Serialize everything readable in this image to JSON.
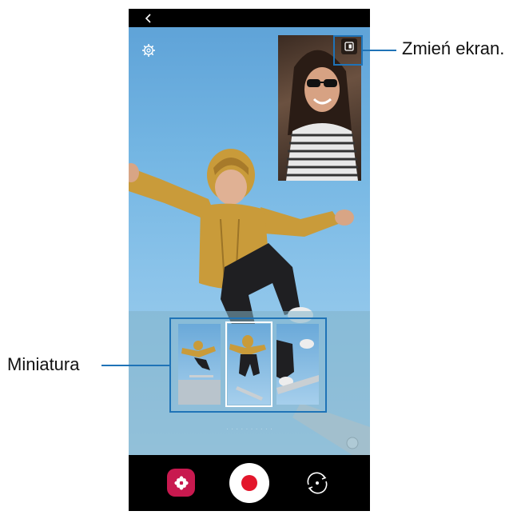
{
  "callouts": {
    "switch_screen": "Zmień ekran.",
    "thumbnail": "Miniatura"
  },
  "icons": {
    "back": "chevron-left-icon",
    "settings": "gear-icon",
    "pip_switch": "switch-screen-icon",
    "effects": "flower-icon",
    "record": "record-icon",
    "flip": "camera-flip-icon"
  },
  "colors": {
    "callout": "#1f73b7",
    "effects_button": "#c8194f",
    "record_dot": "#e3162b"
  },
  "thumbnails": {
    "count": 3,
    "selected_index": 2
  }
}
